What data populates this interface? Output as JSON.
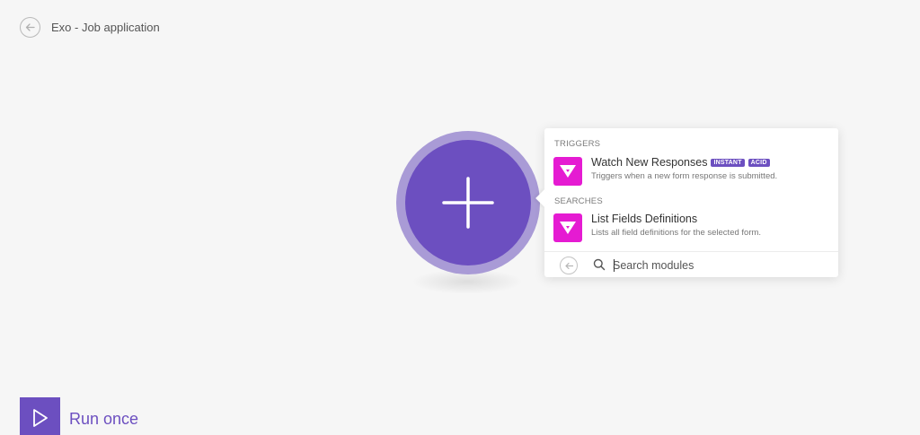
{
  "header": {
    "title": "Exo - Job application",
    "back_icon": "arrow-left-circle-icon"
  },
  "canvas": {
    "add_module_icon": "plus-icon",
    "colors": {
      "accent": "#6c4fc0",
      "accent_ring": "#a99bd6",
      "app_icon": "#e51bd2"
    }
  },
  "popup": {
    "sections": [
      {
        "label": "TRIGGERS",
        "modules": [
          {
            "title": "Watch New Responses",
            "badges": [
              "INSTANT",
              "ACID"
            ],
            "description": "Triggers when a new form response is submitted."
          }
        ]
      },
      {
        "label": "SEARCHES",
        "modules": [
          {
            "title": "List Fields Definitions",
            "badges": [],
            "description": "Lists all field definitions for the selected form."
          }
        ]
      }
    ],
    "search": {
      "placeholder": "Search modules",
      "value": ""
    }
  },
  "footer": {
    "run_label": "Run once",
    "run_icon": "play-icon"
  }
}
